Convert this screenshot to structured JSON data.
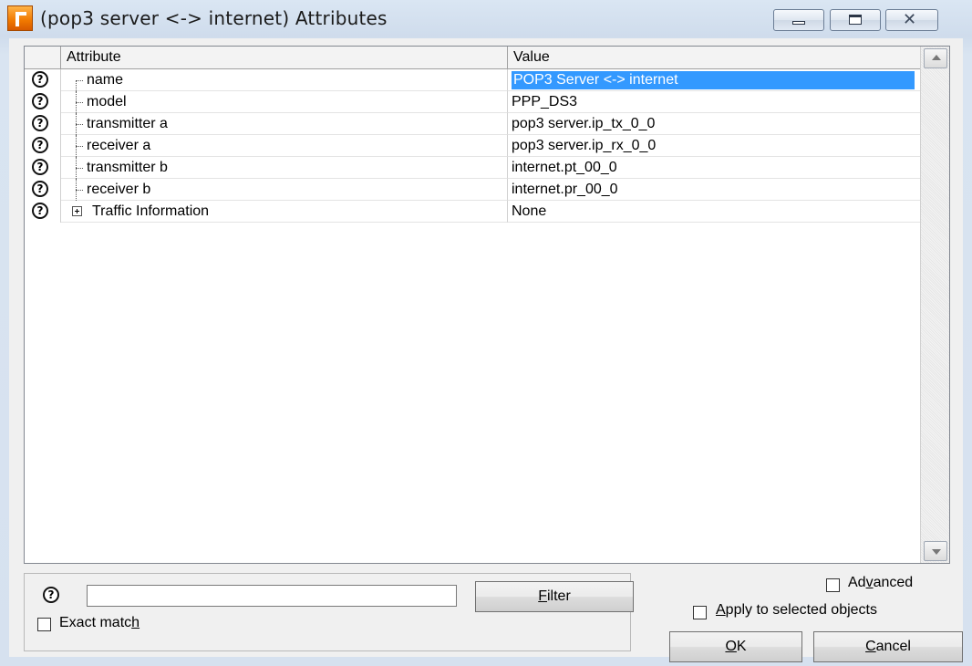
{
  "window": {
    "title": "(pop3 server <-> internet) Attributes",
    "caption_buttons": {
      "minimize": "minimize",
      "maximize": "maximize",
      "close": "✕"
    }
  },
  "grid": {
    "columns": {
      "attribute": "Attribute",
      "value": "Value"
    },
    "rows": [
      {
        "attribute": "name",
        "value": "POP3 Server <-> internet",
        "selected": true
      },
      {
        "attribute": "model",
        "value": "PPP_DS3"
      },
      {
        "attribute": "transmitter a",
        "value": "pop3 server.ip_tx_0_0"
      },
      {
        "attribute": "receiver a",
        "value": "pop3 server.ip_rx_0_0"
      },
      {
        "attribute": "transmitter b",
        "value": "internet.pt_00_0"
      },
      {
        "attribute": "receiver b",
        "value": "internet.pr_00_0"
      },
      {
        "attribute": "Traffic Information",
        "value": "None",
        "expandable": true
      }
    ],
    "help_icon": "?"
  },
  "filter": {
    "help_icon": "?",
    "input_value": "",
    "button_label_prefix": "",
    "button_label_underlined": "F",
    "button_label_rest": "ilter",
    "exact_match_prefix": "Exact matc",
    "exact_match_underlined": "h",
    "exact_match_checked": false
  },
  "options": {
    "advanced_prefix": "Ad",
    "advanced_underlined": "v",
    "advanced_rest": "anced",
    "advanced_checked": false,
    "apply_underlined": "A",
    "apply_rest": "pply to selected objects",
    "apply_checked": false
  },
  "buttons": {
    "ok_underlined": "O",
    "ok_rest": "K",
    "cancel_underlined": "C",
    "cancel_rest": "ancel"
  },
  "colors": {
    "selection": "#3399ff",
    "app_icon": "#f07800"
  }
}
